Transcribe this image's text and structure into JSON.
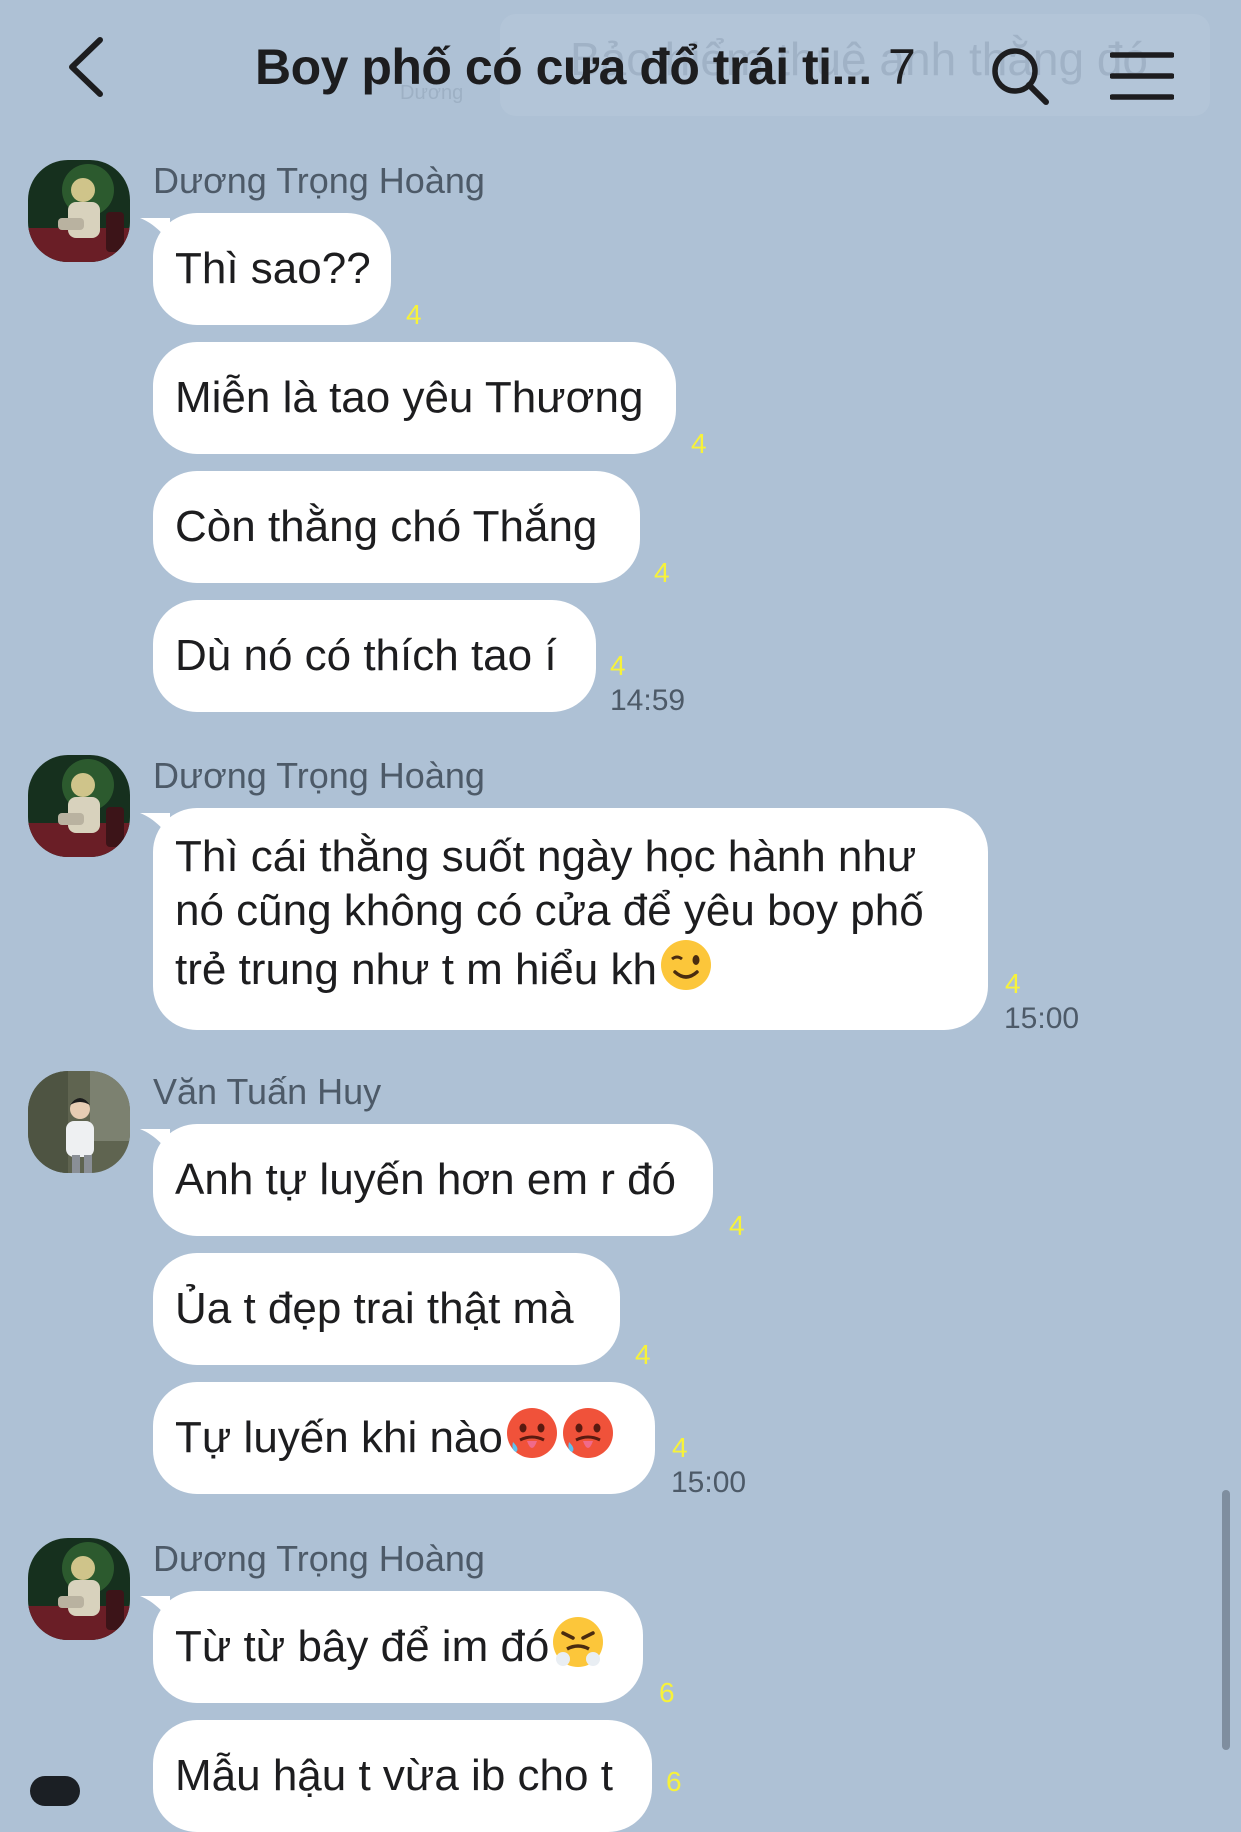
{
  "header": {
    "title": "Boy phố có cưa đổ trái ti...",
    "member_count": "7",
    "ghost_text": "Bảo hiểm thuê anh thằng đó",
    "ghost_sub": "Dương"
  },
  "messages": [
    {
      "sender": "Dương Trọng Hoàng",
      "bubbles": [
        {
          "text": "Thì sao??",
          "read": "4"
        },
        {
          "text": "Miễn là tao yêu Thương",
          "read": "4"
        },
        {
          "text": "Còn thằng chó Thắng",
          "read": "4"
        },
        {
          "text": "Dù nó có thích tao í",
          "read": "4",
          "time": "14:59"
        }
      ]
    },
    {
      "sender": "Dương Trọng Hoàng",
      "bubbles": [
        {
          "lines": [
            "Thì cái thằng suốt ngày học hành như",
            "nó cũng không có cửa để yêu boy phố",
            "trẻ trung như t m hiểu kh"
          ],
          "emoji": "winking-face",
          "read": "4",
          "time": "15:00"
        }
      ]
    },
    {
      "sender": "Văn Tuấn Huy",
      "bubbles": [
        {
          "text": "Anh tự luyến hơn em r đó",
          "read": "4"
        },
        {
          "text": "Ủa t đẹp trai thật mà",
          "read": "4"
        },
        {
          "text": "Tự luyến khi nào",
          "emoji": "hot-face",
          "read": "4",
          "time": "15:00"
        }
      ]
    },
    {
      "sender": "Dương Trọng Hoàng",
      "bubbles": [
        {
          "text": "Từ từ bây để im đó",
          "emoji": "steam-nose-face",
          "read": "6"
        },
        {
          "text": "Mẫu hậu t vừa ib cho t",
          "read": "6"
        }
      ]
    }
  ],
  "colors": {
    "background": "#aec1d5",
    "bubble": "#ffffff",
    "read_count": "#f7f23a",
    "meta_text": "#4d5a68"
  }
}
